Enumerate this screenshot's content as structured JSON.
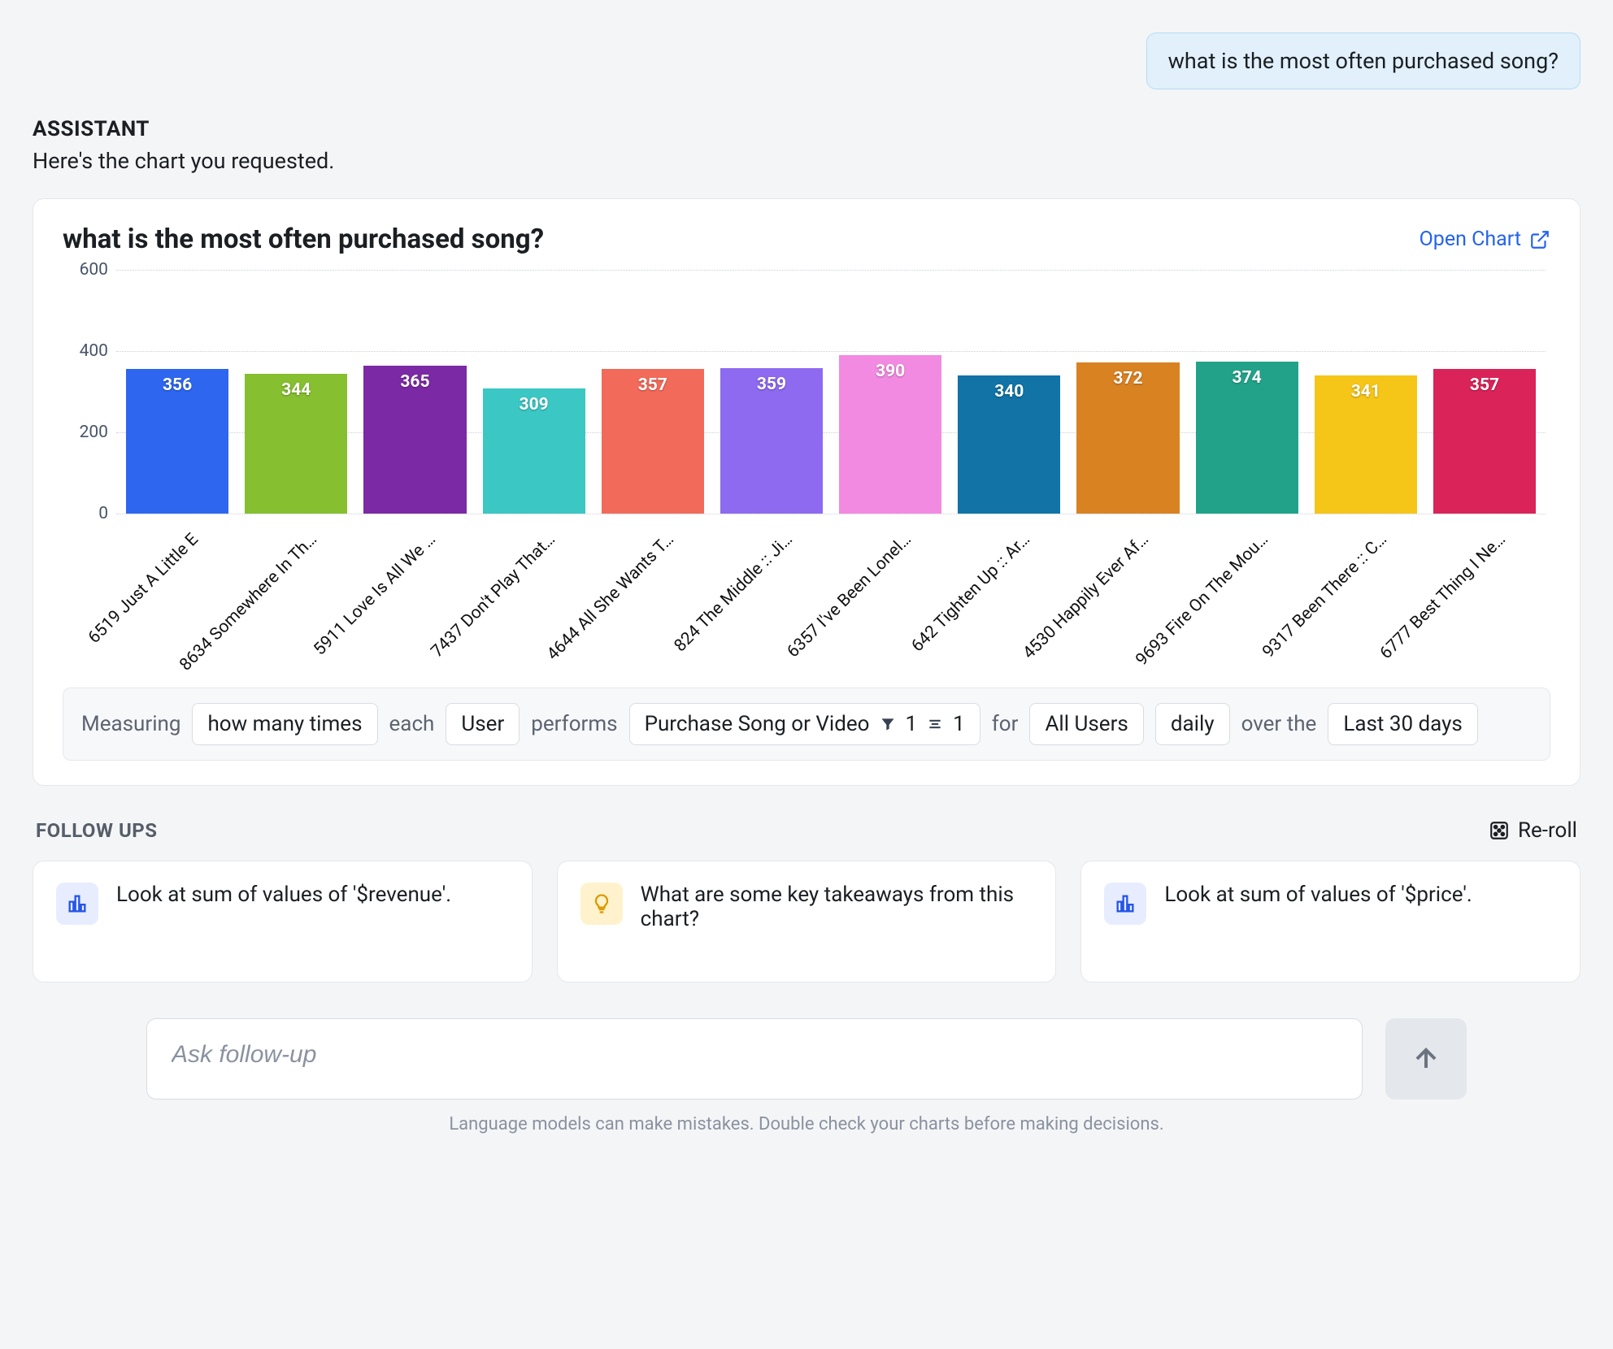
{
  "conversation": {
    "user_message": "what is the most often purchased song?",
    "assistant_label": "ASSISTANT",
    "assistant_text": "Here's the chart you requested."
  },
  "chart": {
    "title": "what is the most often purchased song?",
    "open_label": "Open Chart"
  },
  "chart_data": {
    "type": "bar",
    "ylim": [
      0,
      600
    ],
    "yticks": [
      0,
      200,
      400,
      600
    ],
    "categories": [
      "6519 Just A Little E",
      "8634 Somewhere In Th…",
      "5911 Love Is All We …",
      "7437 Don't Play That…",
      "4644 All She Wants T…",
      "824 The Middle :: Ji…",
      "6357 I've Been Lonel…",
      "642 Tighten Up :: Ar…",
      "4530 Happily Ever Af…",
      "9693 Fire On The Mou…",
      "9317 Been There :: C…",
      "6777 Best Thing I Ne…"
    ],
    "values": [
      356,
      344,
      365,
      309,
      357,
      359,
      390,
      340,
      372,
      374,
      341,
      357
    ],
    "colors": [
      "#2e66ef",
      "#86bf2f",
      "#7b29a5",
      "#3bc7c3",
      "#f26a5a",
      "#8d6aef",
      "#f28ae1",
      "#1173a6",
      "#d98222",
      "#22a389",
      "#f5c518",
      "#d92359"
    ]
  },
  "measuring": {
    "label_measuring": "Measuring",
    "chip_howmany": "how many times",
    "label_each": "each",
    "chip_user": "User",
    "label_performs": "performs",
    "chip_event": "Purchase Song or Video",
    "chip_event_filter_count": "1",
    "chip_event_group_count": "1",
    "label_for": "for",
    "chip_segment": "All Users",
    "chip_interval": "daily",
    "label_over": "over the",
    "chip_range": "Last 30 days"
  },
  "followups": {
    "heading": "FOLLOW UPS",
    "reroll_label": "Re-roll",
    "items": [
      {
        "icon": "bar-chart",
        "text": "Look at sum of values of '$revenue'."
      },
      {
        "icon": "lightbulb",
        "text": "What are some key takeaways from this chart?"
      },
      {
        "icon": "bar-chart",
        "text": "Look at sum of values of '$price'."
      }
    ]
  },
  "input": {
    "placeholder": "Ask follow-up"
  },
  "disclaimer": "Language models can make mistakes. Double check your charts before making decisions."
}
